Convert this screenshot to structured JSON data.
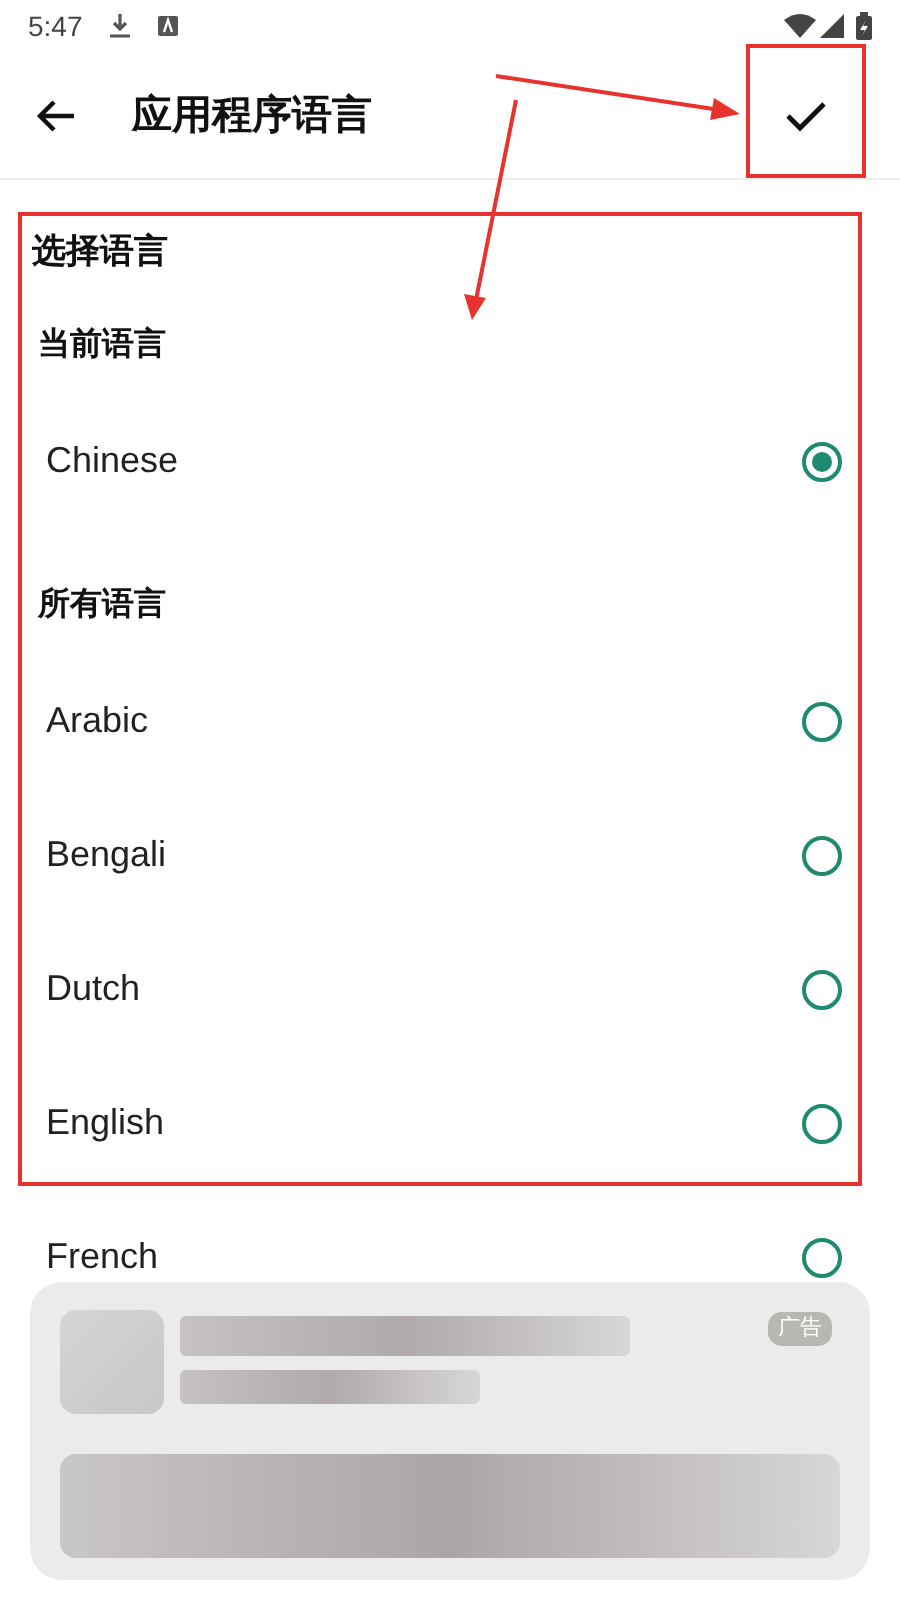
{
  "status_bar": {
    "time": "5:47"
  },
  "app_bar": {
    "title": "应用程序语言"
  },
  "heading": "选择语言",
  "sections": [
    {
      "title": "当前语言",
      "languages": [
        {
          "name": "Chinese",
          "selected": true
        }
      ]
    },
    {
      "title": "所有语言",
      "languages": [
        {
          "name": "Arabic",
          "selected": false
        },
        {
          "name": "Bengali",
          "selected": false
        },
        {
          "name": "Dutch",
          "selected": false
        },
        {
          "name": "English",
          "selected": false
        },
        {
          "name": "French",
          "selected": false
        }
      ]
    }
  ],
  "ad": {
    "badge": "广告"
  }
}
